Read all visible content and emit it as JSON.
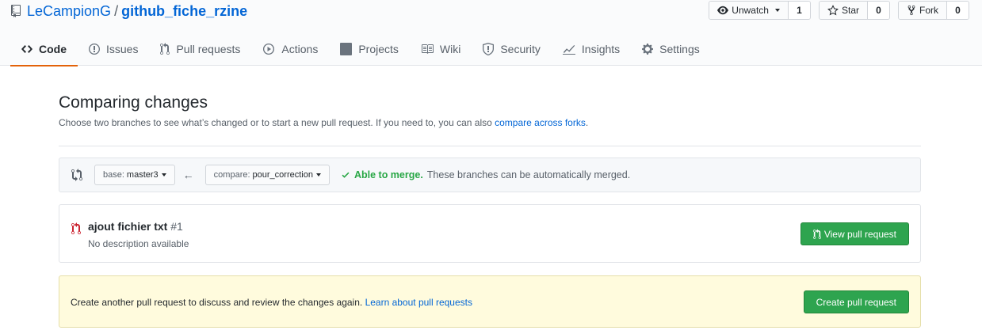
{
  "repo": {
    "owner": "LeCampionG",
    "separator": "/",
    "name": "github_fiche_rzine"
  },
  "actions": {
    "watch": {
      "label": "Unwatch",
      "count": "1"
    },
    "star": {
      "label": "Star",
      "count": "0"
    },
    "fork": {
      "label": "Fork",
      "count": "0"
    }
  },
  "tabs": [
    {
      "label": "Code",
      "icon": "code-icon",
      "selected": true
    },
    {
      "label": "Issues",
      "icon": "issue-icon"
    },
    {
      "label": "Pull requests",
      "icon": "pull-request-icon"
    },
    {
      "label": "Actions",
      "icon": "play-icon"
    },
    {
      "label": "Projects",
      "icon": "project-icon"
    },
    {
      "label": "Wiki",
      "icon": "book-icon"
    },
    {
      "label": "Security",
      "icon": "shield-icon"
    },
    {
      "label": "Insights",
      "icon": "graph-icon"
    },
    {
      "label": "Settings",
      "icon": "gear-icon"
    }
  ],
  "compare": {
    "title": "Comparing changes",
    "subtitle_prefix": "Choose two branches to see what’s changed or to start a new pull request. If you need to, you can also ",
    "subtitle_link": "compare across forks",
    "subtitle_suffix": ".",
    "base_label": "base:",
    "base_value": "master3",
    "compare_label": "compare:",
    "compare_value": "pour_correction",
    "merge_ok": "Able to merge.",
    "merge_text": "These branches can be automatically merged."
  },
  "existing_pr": {
    "title": "ajout fichier txt",
    "number": "#1",
    "description": "No description available",
    "button": "View pull request"
  },
  "notice": {
    "text": "Create another pull request to discuss and review the changes again. ",
    "link": "Learn about pull requests",
    "button": "Create pull request"
  },
  "colors": {
    "link": "#0366d6",
    "green": "#2ea44f",
    "tab_underline": "#e36209",
    "notice_bg": "#fffbdd"
  }
}
